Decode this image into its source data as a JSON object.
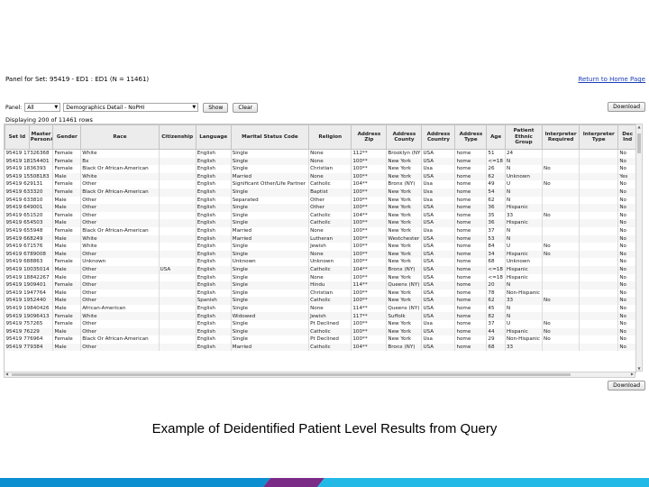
{
  "header": {
    "title": "Panel for Set: 95419 - ED1 : ED1 (N = 11461)",
    "return_link": "Return to Home Page"
  },
  "controls": {
    "panel_label": "Panel:",
    "panel_value": "All",
    "view_value": "Demographics Detail - NoPHI",
    "show_label": "Show",
    "clear_label": "Clear",
    "download_label": "Download"
  },
  "row_count": "Displaying 200 of 11461 rows",
  "columns": [
    "Set Id",
    "Master Person#",
    "Gender",
    "Race",
    "Citizenship",
    "Language",
    "Marital Status Code",
    "Religion",
    "Address Zip",
    "Address County",
    "Address Country",
    "Address Type",
    "Age",
    "Patient Ethnic Group",
    "Interpreter Required",
    "Interpreter Type",
    "Dec Ind"
  ],
  "rows": [
    [
      "95419 17326368",
      "Female",
      "White",
      "",
      "English",
      "Single",
      "None",
      "112**",
      "Brooklyn (NY)",
      "USA",
      "home",
      "51",
      "24",
      "",
      "",
      "No"
    ],
    [
      "95419 18154401",
      "Female",
      "Bx",
      "",
      "English",
      "Single",
      "None",
      "100**",
      "New York",
      "USA",
      "home",
      "<=18",
      "N",
      "",
      "",
      "No"
    ],
    [
      "95419 1836393",
      "Female",
      "Black Or African-American",
      "",
      "English",
      "Single",
      "Christian",
      "100**",
      "New York",
      "Usa",
      "home",
      "26",
      "N",
      "No",
      "",
      "No"
    ],
    [
      "95419 15508183",
      "Male",
      "White",
      "",
      "English",
      "Married",
      "None",
      "100**",
      "New York",
      "USA",
      "home",
      "62",
      "Unknown",
      "",
      "",
      "Yes"
    ],
    [
      "95419 629131",
      "Female",
      "Other",
      "",
      "English",
      "Significant Other/Life Partner",
      "Catholic",
      "104**",
      "Bronx (NY)",
      "Usa",
      "home",
      "49",
      "U",
      "No",
      "",
      "No"
    ],
    [
      "95419 633320",
      "Female",
      "Black Or African-American",
      "",
      "English",
      "Single",
      "Baptist",
      "100**",
      "New York",
      "Usa",
      "home",
      "54",
      "N",
      "",
      "",
      "No"
    ],
    [
      "95419 633810",
      "Male",
      "Other",
      "",
      "English",
      "Separated",
      "Other",
      "100**",
      "New York",
      "Usa",
      "home",
      "62",
      "N",
      "",
      "",
      "No"
    ],
    [
      "95419 649001",
      "Male",
      "Other",
      "",
      "English",
      "Single",
      "Other",
      "100**",
      "New York",
      "USA",
      "home",
      "36",
      "Hispanic",
      "",
      "",
      "No"
    ],
    [
      "95419 651520",
      "Female",
      "Other",
      "",
      "English",
      "Single",
      "Catholic",
      "104**",
      "New York",
      "USA",
      "home",
      "35",
      "33",
      "No",
      "",
      "No"
    ],
    [
      "95419 654503",
      "Male",
      "Other",
      "",
      "English",
      "Single",
      "Catholic",
      "100**",
      "New York",
      "USA",
      "home",
      "36",
      "Hispanic",
      "",
      "",
      "No"
    ],
    [
      "95419 655948",
      "Female",
      "Black Or African-American",
      "",
      "English",
      "Married",
      "None",
      "100**",
      "New York",
      "Usa",
      "home",
      "37",
      "N",
      "",
      "",
      "No"
    ],
    [
      "95419 668249",
      "Male",
      "White",
      "",
      "English",
      "Married",
      "Lutheran",
      "100**",
      "Westchester",
      "USA",
      "home",
      "53",
      "N",
      "",
      "",
      "No"
    ],
    [
      "95419 671576",
      "Male",
      "White",
      "",
      "English",
      "Single",
      "Jewish",
      "100**",
      "New York",
      "USA",
      "home",
      "84",
      "U",
      "No",
      "",
      "No"
    ],
    [
      "95419 6789008",
      "Male",
      "Other",
      "",
      "English",
      "Single",
      "None",
      "100**",
      "New York",
      "USA",
      "home",
      "34",
      "Hispanic",
      "No",
      "",
      "No"
    ],
    [
      "95419 688863",
      "Female",
      "Unknown",
      "",
      "English",
      "Unknown",
      "Unknown",
      "100**",
      "New York",
      "USA",
      "home",
      "68",
      "Unknown",
      "",
      "",
      "No"
    ],
    [
      "95419 10035014",
      "Male",
      "Other",
      "USA",
      "English",
      "Single",
      "Catholic",
      "104**",
      "Bronx (NY)",
      "USA",
      "home",
      "<=18",
      "Hispanic",
      "",
      "",
      "No"
    ],
    [
      "95419 18842267",
      "Male",
      "Other",
      "",
      "English",
      "Single",
      "None",
      "100**",
      "New York",
      "USA",
      "home",
      "<=18",
      "Hispanic",
      "",
      "",
      "No"
    ],
    [
      "95419 1909401",
      "Female",
      "Other",
      "",
      "English",
      "Single",
      "Hindu",
      "114**",
      "Queens (NY)",
      "USA",
      "home",
      "20",
      "N",
      "",
      "",
      "No"
    ],
    [
      "95419 1947764",
      "Male",
      "Other",
      "",
      "English",
      "Single",
      "Christian",
      "100**",
      "New York",
      "USA",
      "home",
      "78",
      "Non-Hispanic",
      "",
      "",
      "No"
    ],
    [
      "95419 1952440",
      "Male",
      "Other",
      "",
      "Spanish",
      "Single",
      "Catholic",
      "100**",
      "New York",
      "USA",
      "home",
      "62",
      "33",
      "No",
      "",
      "No"
    ],
    [
      "95419 19840426",
      "Male",
      "African-American",
      "",
      "English",
      "Single",
      "None",
      "114**",
      "Queens (NY)",
      "USA",
      "home",
      "45",
      "N",
      "",
      "",
      "No"
    ],
    [
      "95419 19096413",
      "Female",
      "White",
      "",
      "English",
      "Widowed",
      "Jewish",
      "117**",
      "Suffolk",
      "USA",
      "home",
      "82",
      "N",
      "",
      "",
      "No"
    ],
    [
      "95419 757265",
      "Female",
      "Other",
      "",
      "English",
      "Single",
      "Pt Declined",
      "100**",
      "New York",
      "Usa",
      "home",
      "37",
      "U",
      "No",
      "",
      "No"
    ],
    [
      "95419 76229",
      "Male",
      "Other",
      "",
      "English",
      "Single",
      "Catholic",
      "100**",
      "New York",
      "USA",
      "home",
      "44",
      "Hispanic",
      "No",
      "",
      "No"
    ],
    [
      "95419 776964",
      "Female",
      "Black Or African-American",
      "",
      "English",
      "Single",
      "Pt Declined",
      "100**",
      "New York",
      "Usa",
      "home",
      "29",
      "Non-Hispanic",
      "No",
      "",
      "No"
    ],
    [
      "95419 779384",
      "Male",
      "Other",
      "",
      "English",
      "Married",
      "Catholic",
      "104**",
      "Bronx (NY)",
      "USA",
      "home",
      "68",
      "33",
      "",
      "",
      "No"
    ]
  ],
  "caption": "Example of Deidentified Patient Level Results from Query",
  "colors": {
    "link": "#1a3fb8",
    "footer_blue": "#0b8fd1",
    "footer_purple": "#7a2b86",
    "footer_cyan": "#23b9e6"
  }
}
